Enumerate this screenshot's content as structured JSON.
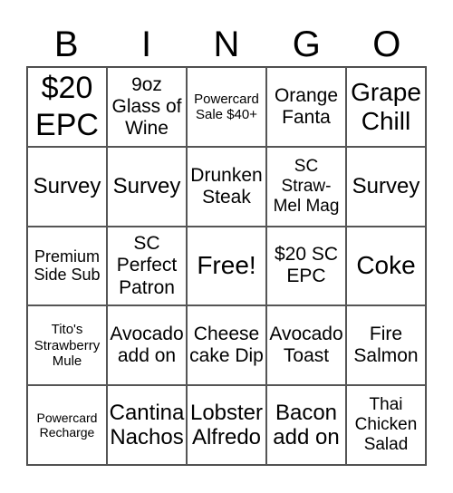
{
  "header": {
    "letters": [
      "B",
      "I",
      "N",
      "G",
      "O"
    ]
  },
  "card": {
    "cells": [
      "$20 EPC",
      "9oz Glass of Wine",
      "Powercard Sale $40+",
      "Orange Fanta",
      "Grape Chill",
      "Survey",
      "Survey",
      "Drunken Steak",
      "SC Straw-Mel Mag",
      "Survey",
      "Premium Side Sub",
      "SC Perfect Patron",
      "Free!",
      "$20 SC EPC",
      "Coke",
      "Tito's Strawberry Mule",
      "Avocado add on",
      "Cheese cake Dip",
      "Avocado Toast",
      "Fire Salmon",
      "Powercard Recharge",
      "Cantina Nachos",
      "Lobster Alfredo",
      "Bacon add on",
      "Thai Chicken Salad"
    ]
  }
}
